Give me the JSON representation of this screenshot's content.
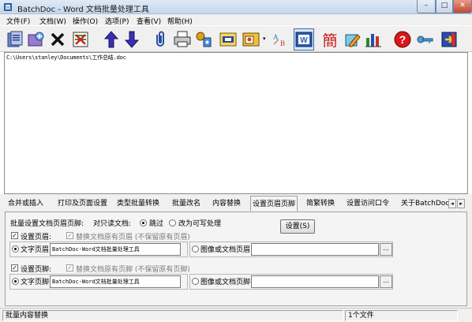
{
  "window": {
    "title": "BatchDoc - Word 文档批量处理工具"
  },
  "window_buttons": {
    "minimize": "–",
    "maximize": "□",
    "close": "✕"
  },
  "menu": [
    "文件(F)",
    "文档(W)",
    "操作(O)",
    "选项(P)",
    "查看(V)",
    "帮助(H)"
  ],
  "toolbar": {
    "icons": [
      "add-files-icon",
      "add-folder-icon",
      "delete-icon",
      "clear-list-icon",
      "move-up-icon",
      "move-down-icon",
      "attach-icon",
      "print-icon",
      "tools-icon",
      "rename-icon",
      "image-icon",
      "spell-check-icon",
      "word-icon",
      "traditional-chinese-icon",
      "edit-icon",
      "statistics-icon",
      "help-icon",
      "key-icon",
      "exit-icon"
    ],
    "dropdown_glyph": "▾",
    "traditional_char": "簡"
  },
  "file_list": {
    "items": [
      "C:\\Users\\stanley\\Documents\\工作总结.doc"
    ]
  },
  "tabs": {
    "items": [
      "合并或插入",
      "打印及页面设置",
      "类型批量转换",
      "批量改名",
      "内容替换",
      "设置页眉页脚",
      "简繁转换",
      "设置访问口令",
      "关于BatchDoc"
    ],
    "active_index": 5,
    "scroll_left": "◂",
    "scroll_right": "▸"
  },
  "header_footer": {
    "section_label": "批量设置文档页眉页脚:",
    "readonly_label": "对只读文档:",
    "skip_label": "跳过",
    "rewrite_label": "改为可写处理",
    "readonly_choice": "skip",
    "set_button": "设置(S)",
    "header": {
      "checkbox_label": "设置页眉:",
      "checked": true,
      "replace_label": "替换文档原有页眉 (不保留原有页眉)",
      "replace_checked": true,
      "text_radio_label": "文字页眉",
      "text_value": "BatchDoc-Word文档批量处理工具",
      "image_radio_label": "图像或文档页眉",
      "image_value": "",
      "mode": "text"
    },
    "footer": {
      "checkbox_label": "设置页脚:",
      "checked": true,
      "replace_label": "替换文档原有页脚 (不保留原有页脚)",
      "replace_checked": true,
      "text_radio_label": "文字页脚",
      "text_value": "BatchDoc-Word文档批量处理工具",
      "image_radio_label": "图像或文档页脚",
      "image_value": "",
      "mode": "text"
    },
    "browse_label": "..."
  },
  "status": {
    "left": "批量内容替换",
    "count": "1个文件"
  },
  "colors": {
    "accent": "#3a6ea5",
    "titlebar": "#c5d7ec",
    "close": "#c04a32"
  }
}
